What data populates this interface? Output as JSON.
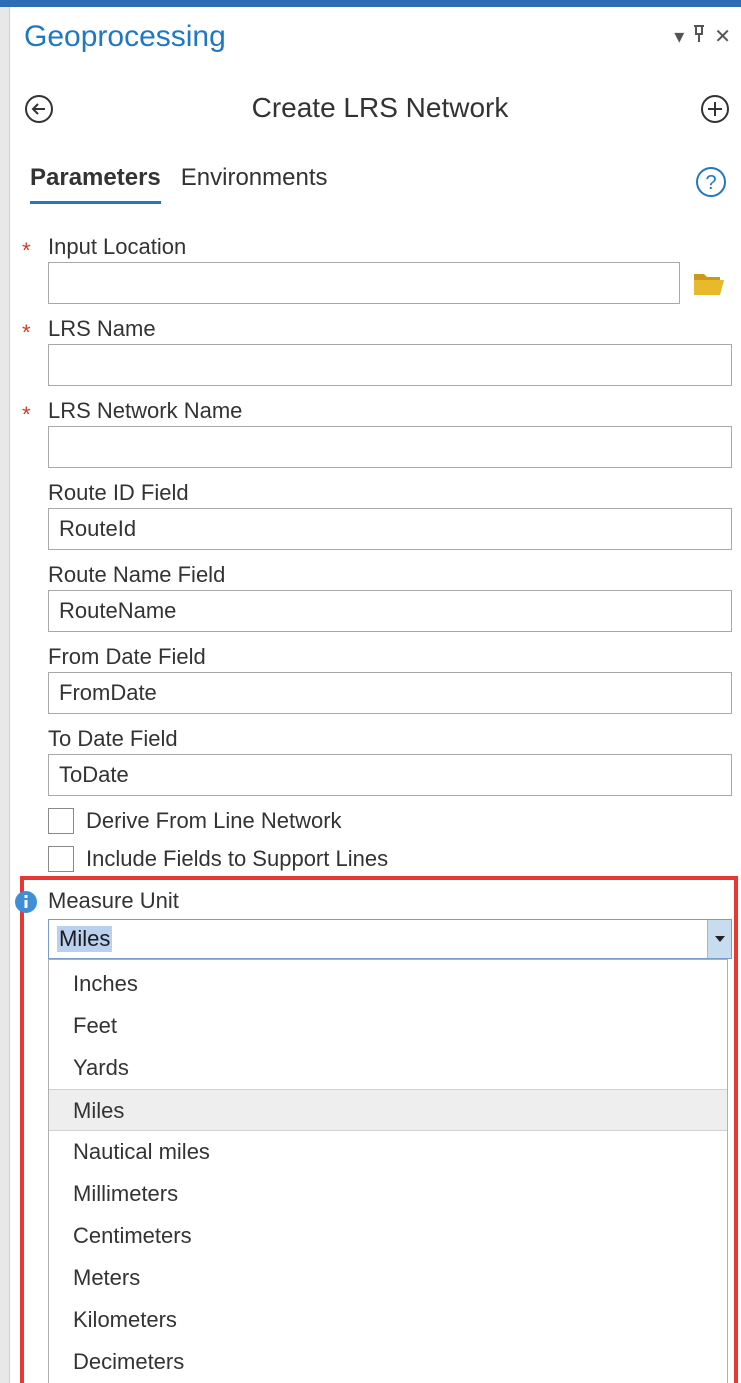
{
  "pane": {
    "title": "Geoprocessing",
    "controls": {
      "menu": "▾",
      "pin": "ᵖ",
      "close": "✕"
    }
  },
  "tool": {
    "title": "Create LRS Network"
  },
  "tabs": [
    {
      "label": "Parameters",
      "active": true
    },
    {
      "label": "Environments",
      "active": false
    }
  ],
  "params": {
    "required_marker": "*",
    "input_location": {
      "label": "Input Location",
      "value": ""
    },
    "lrs_name": {
      "label": "LRS Name",
      "value": ""
    },
    "lrs_network_name": {
      "label": "LRS Network Name",
      "value": ""
    },
    "route_id_field": {
      "label": "Route ID Field",
      "value": "RouteId"
    },
    "route_name_field": {
      "label": "Route Name Field",
      "value": "RouteName"
    },
    "from_date_field": {
      "label": "From Date Field",
      "value": "FromDate"
    },
    "to_date_field": {
      "label": "To Date Field",
      "value": "ToDate"
    },
    "derive_from_line_network": {
      "label": "Derive From Line Network",
      "checked": false
    },
    "include_fields_support_lines": {
      "label": "Include Fields to Support Lines",
      "checked": false
    },
    "measure_unit": {
      "label": "Measure Unit",
      "value": "Miles",
      "options": [
        "Inches",
        "Feet",
        "Yards",
        "Miles",
        "Nautical miles",
        "Millimeters",
        "Centimeters",
        "Meters",
        "Kilometers",
        "Decimeters"
      ]
    }
  },
  "colors": {
    "accent": "#1f78c1",
    "required": "#d43c1f",
    "highlight": "#e53935",
    "selection": "#b9d1ee"
  }
}
